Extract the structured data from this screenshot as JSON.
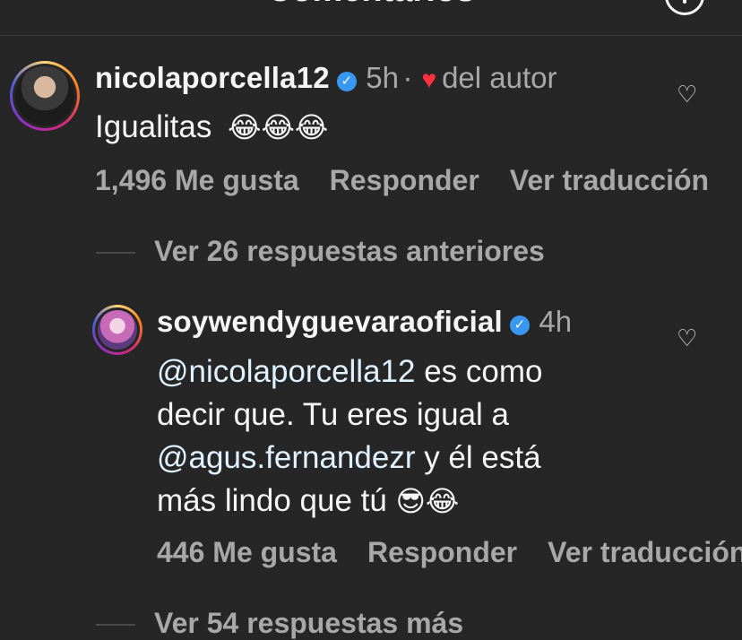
{
  "header": {
    "title": "Comentarios"
  },
  "comment_1": {
    "username": "nicolaporcella12",
    "time": "5h",
    "separator": "·",
    "author_like_label": "del autor",
    "text": "Igualitas",
    "emojis": "😂😂😂",
    "likes": "1,496 Me gusta",
    "reply": "Responder",
    "translate": "Ver traducción"
  },
  "previous_replies": "Ver 26 respuestas anteriores",
  "comment_2": {
    "username": "soywendyguevaraoficial",
    "time": "4h",
    "mention_1": "@nicolaporcella12",
    "text_1": " es como",
    "text_2": "decir que. Tu eres igual a",
    "mention_2": "@agus.fernandezr",
    "text_3": "  y él está",
    "text_4": "más lindo que tú",
    "emojis": "😎😂",
    "likes": "446 Me gusta",
    "reply": "Responder",
    "translate": "Ver traducción"
  },
  "more_replies": "Ver 54 respuestas más",
  "colors": {
    "background": "#262626",
    "verified": "#3897f0",
    "heart": "#ff3040",
    "muted_text": "#a8a8a8"
  },
  "icons": [
    "info-icon",
    "verified-badge-icon",
    "red-heart-icon",
    "like-heart-icon"
  ]
}
